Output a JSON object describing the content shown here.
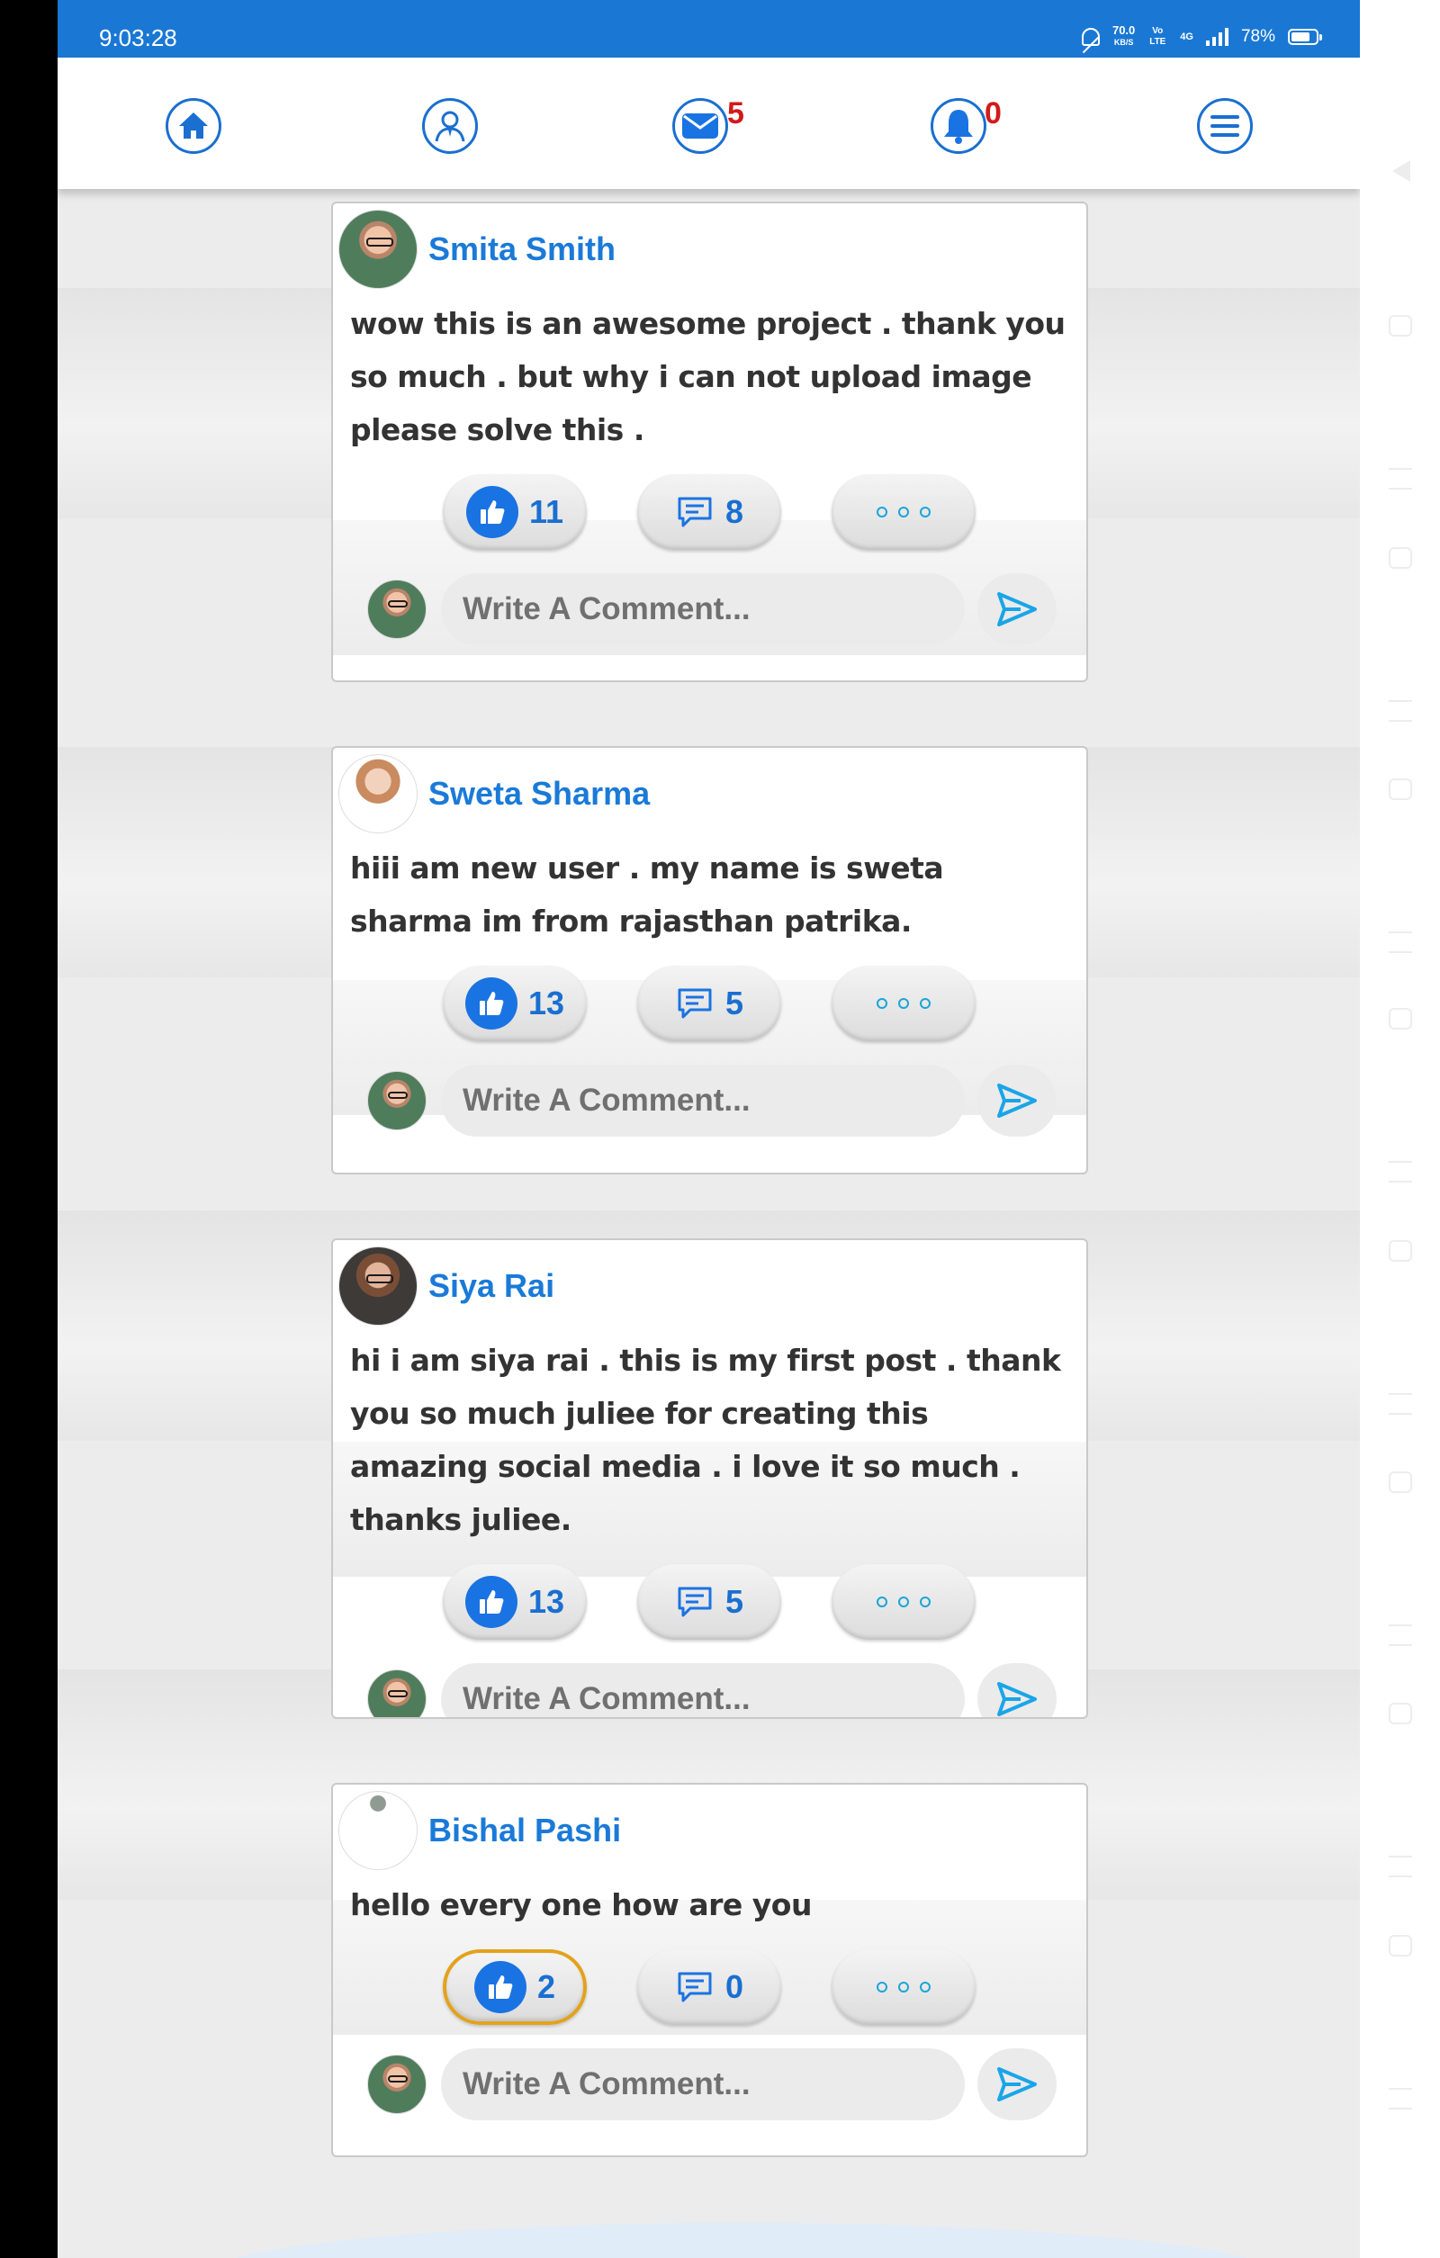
{
  "status_bar": {
    "time": "9:03:28",
    "net_speed_value": "70.0",
    "net_speed_unit": "KB/S",
    "volte": "Vo LTE",
    "network": "4G",
    "battery": "78%",
    "battery_level": 0.78
  },
  "nav": {
    "messages_count": "5",
    "notifications_count": "0",
    "icons": [
      "home-icon",
      "profile-icon",
      "mail-icon",
      "bell-icon",
      "menu-icon"
    ]
  },
  "colors": {
    "accent": "#1a78d4",
    "name": "#1a7ad8",
    "badge": "#d21a1a",
    "active_like_border": "#e3a21b"
  },
  "posts": [
    {
      "author": "Smita Smith",
      "text": "wow this is an awesome project . thank you so much . but why i can not upload image please solve this .",
      "likes": "11",
      "comments": "8",
      "comment_placeholder": "Write A Comment..."
    },
    {
      "author": "Sweta Sharma",
      "text": "hiii am new user . my name is sweta sharma im from rajasthan patrika.",
      "likes": "13",
      "comments": "5",
      "comment_placeholder": "Write A Comment..."
    },
    {
      "author": "Siya Rai",
      "text": "hi i am siya rai . this is my first post . thank you so much juliee for creating this amazing social media . i love it so much . thanks juliee.",
      "likes": "13",
      "comments": "5",
      "comment_placeholder": "Write A Comment..."
    },
    {
      "author": "Bishal Pashi",
      "text": "hello every one how are you",
      "likes": "2",
      "comments": "0",
      "liked_by_me": true,
      "comment_placeholder": "Write A Comment..."
    }
  ]
}
